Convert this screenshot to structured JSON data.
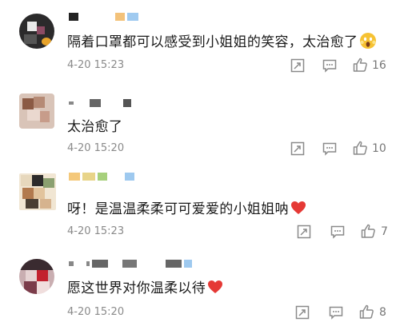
{
  "comments": [
    {
      "text": "隔着口罩都可以感受到小姐姐的笑容，太治愈了",
      "emoji": "scream-face-emoji",
      "time": "4-20 15:23",
      "likes": "16"
    },
    {
      "text": "太治愈了",
      "emoji": "",
      "time": "4-20 15:20",
      "likes": "10"
    },
    {
      "text": "呀！是温温柔柔可可爱爱的小姐姐呐",
      "emoji": "red-heart-emoji",
      "time": "4-20 15:23",
      "likes": "7"
    },
    {
      "text": "愿这世界对你温柔以待",
      "emoji": "red-heart-emoji",
      "time": "4-20 15:20",
      "likes": "8"
    }
  ],
  "icons": {
    "share": "share-icon",
    "reply": "comment-icon",
    "like": "thumbs-up-icon"
  },
  "colors": {
    "text": "#1a1a1a",
    "meta": "#8a8a8a",
    "icon": "#8a8a8a",
    "heart": "#e53935"
  }
}
